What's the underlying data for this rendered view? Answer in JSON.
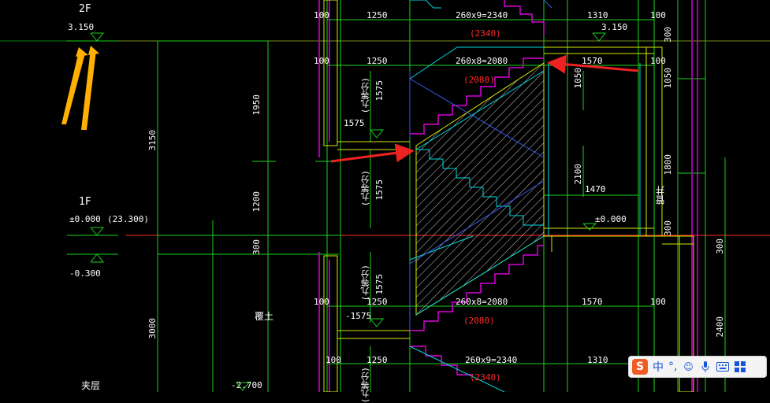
{
  "labels": {
    "floor_2f": "2F",
    "elev_3150": "3.150",
    "floor_1f": "1F",
    "elev_000": "±0.000",
    "elev_23300": "(23.300)",
    "elev_m0300": "-0.300",
    "basement": "夹层",
    "elev_m2700": "-2.700",
    "backfill": "覆土",
    "dim_3150": "3150",
    "dim_1950": "1950",
    "dim_1200": "1200",
    "dim_300": "300",
    "dim_3000": "3000",
    "d100_a": "100",
    "d1250_a": "1250",
    "d260x9_a": "260x9=2340",
    "d2340_red_a": "(2340)",
    "d1310_a": "1310",
    "d3150_right": "3.150",
    "d100_b": "100",
    "d1250_b": "1250",
    "d260x8_a": "260x8=2080",
    "d2080_red_a": "(2080)",
    "d1570_a": "1570",
    "d1050_a": "1050",
    "d1050_b": "1050",
    "d300_ra": "300",
    "dim_1575_h": "1575",
    "nine_eq_a": "(九等分)",
    "d1575_va": "1575",
    "nine_eq_b": "(九等分)",
    "d1575_vb": "1575",
    "d2100": "2100",
    "d1470": "1470",
    "d1800": "1800",
    "pipe_well": "管井",
    "elev_000_b": "±0.000",
    "d300_rb": "300",
    "d300_rc": "300",
    "nine_eq_c": "(九等分)",
    "d1575_vc": "1575",
    "d100_c": "100",
    "d1250_c": "1250",
    "d260x8_b": "260x8=2080",
    "d1570_b": "1570",
    "d100_right": "100",
    "d2080_red_b": "(2080)",
    "dim_m1575": "-1575",
    "d2400": "2400",
    "d100_d": "100",
    "d1250_d": "1250",
    "d260x9_b": "260x9=2340",
    "d1310_b": "1310",
    "d2340_red_b": "(2340)",
    "nine_eq_d": "(九等分)",
    "d100_top_right": "100",
    "d100_mid_right": "100"
  },
  "ime": {
    "logo": "S",
    "lang": "中",
    "punct": "°,",
    "emoji_icon": "smile-icon",
    "mic_icon": "mic-icon",
    "keyboard_icon": "keyboard-icon",
    "grid_icon": "grid-icon"
  },
  "colors": {
    "background": "#000000",
    "green": "#19d219",
    "yellow_green": "#d9e600",
    "magenta": "#d800d8",
    "cyan": "#00d7e0",
    "red": "#ff2a2a",
    "white": "#ffffff",
    "orange_arrow": "#ffb000",
    "red_arrow": "#ee2222"
  }
}
